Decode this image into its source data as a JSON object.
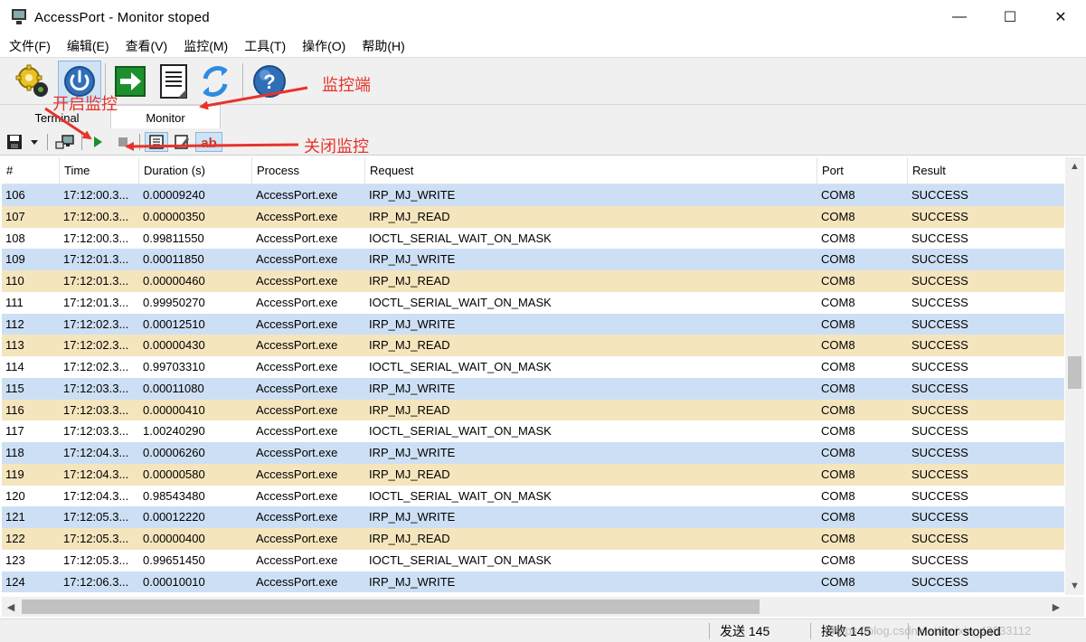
{
  "window": {
    "title": "AccessPort - Monitor  stoped",
    "minimize": "—",
    "maximize": "☐",
    "close": "✕"
  },
  "menu": [
    {
      "label": "文件(F)"
    },
    {
      "label": "编辑(E)"
    },
    {
      "label": "查看(V)"
    },
    {
      "label": "监控(M)"
    },
    {
      "label": "工具(T)"
    },
    {
      "label": "操作(O)"
    },
    {
      "label": "帮助(H)"
    }
  ],
  "toolbar": {
    "icons": [
      "settings-gear-icon",
      "power-icon",
      "exit-arrow-icon",
      "document-icon",
      "refresh-icon",
      "help-icon"
    ],
    "help_glyph": "?"
  },
  "tabs": {
    "terminal": "Terminal",
    "monitor": "Monitor"
  },
  "toolbar2": {
    "icons": [
      "save-icon",
      "dropdown-arrow-icon",
      "port-select-icon",
      "start-monitor-icon",
      "stop-monitor-icon",
      "view-hex-icon",
      "view-edit-icon",
      "view-text-icon"
    ],
    "text_glyph": "ab"
  },
  "table": {
    "columns": [
      "#",
      "Time",
      "Duration (s)",
      "Process",
      "Request",
      "Port",
      "Result"
    ],
    "rows": [
      {
        "id": "106",
        "time": "17:12:00.3...",
        "duration": "0.00009240",
        "process": "AccessPort.exe",
        "request": "IRP_MJ_WRITE",
        "port": "COM8",
        "result": "SUCCESS"
      },
      {
        "id": "107",
        "time": "17:12:00.3...",
        "duration": "0.00000350",
        "process": "AccessPort.exe",
        "request": "IRP_MJ_READ",
        "port": "COM8",
        "result": "SUCCESS"
      },
      {
        "id": "108",
        "time": "17:12:00.3...",
        "duration": "0.99811550",
        "process": "AccessPort.exe",
        "request": "IOCTL_SERIAL_WAIT_ON_MASK",
        "port": "COM8",
        "result": "SUCCESS"
      },
      {
        "id": "109",
        "time": "17:12:01.3...",
        "duration": "0.00011850",
        "process": "AccessPort.exe",
        "request": "IRP_MJ_WRITE",
        "port": "COM8",
        "result": "SUCCESS"
      },
      {
        "id": "110",
        "time": "17:12:01.3...",
        "duration": "0.00000460",
        "process": "AccessPort.exe",
        "request": "IRP_MJ_READ",
        "port": "COM8",
        "result": "SUCCESS"
      },
      {
        "id": "111",
        "time": "17:12:01.3...",
        "duration": "0.99950270",
        "process": "AccessPort.exe",
        "request": "IOCTL_SERIAL_WAIT_ON_MASK",
        "port": "COM8",
        "result": "SUCCESS"
      },
      {
        "id": "112",
        "time": "17:12:02.3...",
        "duration": "0.00012510",
        "process": "AccessPort.exe",
        "request": "IRP_MJ_WRITE",
        "port": "COM8",
        "result": "SUCCESS"
      },
      {
        "id": "113",
        "time": "17:12:02.3...",
        "duration": "0.00000430",
        "process": "AccessPort.exe",
        "request": "IRP_MJ_READ",
        "port": "COM8",
        "result": "SUCCESS"
      },
      {
        "id": "114",
        "time": "17:12:02.3...",
        "duration": "0.99703310",
        "process": "AccessPort.exe",
        "request": "IOCTL_SERIAL_WAIT_ON_MASK",
        "port": "COM8",
        "result": "SUCCESS"
      },
      {
        "id": "115",
        "time": "17:12:03.3...",
        "duration": "0.00011080",
        "process": "AccessPort.exe",
        "request": "IRP_MJ_WRITE",
        "port": "COM8",
        "result": "SUCCESS"
      },
      {
        "id": "116",
        "time": "17:12:03.3...",
        "duration": "0.00000410",
        "process": "AccessPort.exe",
        "request": "IRP_MJ_READ",
        "port": "COM8",
        "result": "SUCCESS"
      },
      {
        "id": "117",
        "time": "17:12:03.3...",
        "duration": "1.00240290",
        "process": "AccessPort.exe",
        "request": "IOCTL_SERIAL_WAIT_ON_MASK",
        "port": "COM8",
        "result": "SUCCESS"
      },
      {
        "id": "118",
        "time": "17:12:04.3...",
        "duration": "0.00006260",
        "process": "AccessPort.exe",
        "request": "IRP_MJ_WRITE",
        "port": "COM8",
        "result": "SUCCESS"
      },
      {
        "id": "119",
        "time": "17:12:04.3...",
        "duration": "0.00000580",
        "process": "AccessPort.exe",
        "request": "IRP_MJ_READ",
        "port": "COM8",
        "result": "SUCCESS"
      },
      {
        "id": "120",
        "time": "17:12:04.3...",
        "duration": "0.98543480",
        "process": "AccessPort.exe",
        "request": "IOCTL_SERIAL_WAIT_ON_MASK",
        "port": "COM8",
        "result": "SUCCESS"
      },
      {
        "id": "121",
        "time": "17:12:05.3...",
        "duration": "0.00012220",
        "process": "AccessPort.exe",
        "request": "IRP_MJ_WRITE",
        "port": "COM8",
        "result": "SUCCESS"
      },
      {
        "id": "122",
        "time": "17:12:05.3...",
        "duration": "0.00000400",
        "process": "AccessPort.exe",
        "request": "IRP_MJ_READ",
        "port": "COM8",
        "result": "SUCCESS"
      },
      {
        "id": "123",
        "time": "17:12:05.3...",
        "duration": "0.99651450",
        "process": "AccessPort.exe",
        "request": "IOCTL_SERIAL_WAIT_ON_MASK",
        "port": "COM8",
        "result": "SUCCESS"
      },
      {
        "id": "124",
        "time": "17:12:06.3...",
        "duration": "0.00010010",
        "process": "AccessPort.exe",
        "request": "IRP_MJ_WRITE",
        "port": "COM8",
        "result": "SUCCESS"
      }
    ],
    "colors": {
      "write": "#cddff4",
      "read": "#f5e5bd",
      "ioctl": "#ffffff"
    }
  },
  "scrollbar": {
    "up": "▲",
    "down": "▼",
    "left": "◀",
    "right": "▶"
  },
  "status": {
    "sent": "发送 145",
    "received": "接收 145",
    "state": "Monitor  stoped",
    "watermark": "https://blog.csdn.net/weixin_43833112"
  },
  "annotations": {
    "start_monitor": "开启监控",
    "monitor_end": "监控端",
    "stop_monitor": "关闭监控",
    "color": "#e8332b"
  }
}
